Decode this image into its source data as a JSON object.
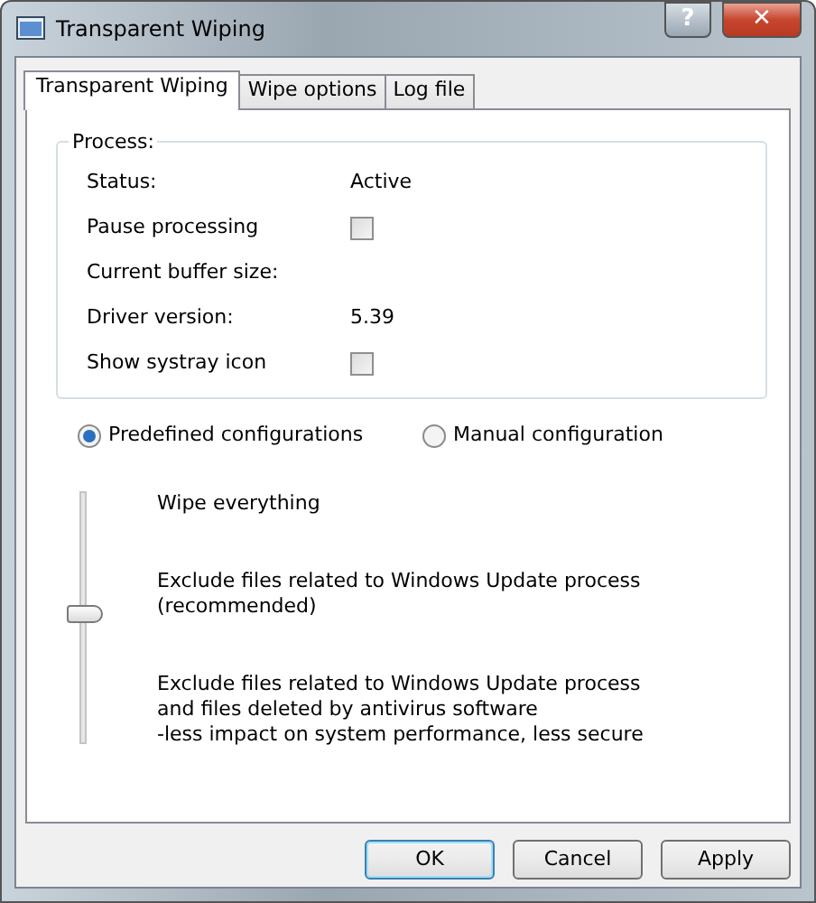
{
  "window": {
    "title": "Transparent Wiping",
    "help_button": "?",
    "close_button": "✕"
  },
  "tabs": [
    {
      "label": "Transparent Wiping",
      "selected": true
    },
    {
      "label": "Wipe options",
      "selected": false
    },
    {
      "label": "Log file",
      "selected": false
    }
  ],
  "process": {
    "title": "Process:",
    "rows": [
      {
        "kind": "value",
        "label": "Status:",
        "value": "Active"
      },
      {
        "kind": "checkbox",
        "label": "Pause processing",
        "checked": false
      },
      {
        "kind": "value",
        "label": "Current buffer size:"
      },
      {
        "kind": "value",
        "label": "Driver version:",
        "value": "5.39"
      },
      {
        "kind": "checkbox",
        "label": "Show systray icon",
        "checked": false
      }
    ]
  },
  "modes": [
    {
      "label": "Predefined configurations",
      "selected": true
    },
    {
      "label": "Manual configuration",
      "selected": false
    }
  ],
  "preset_slider": {
    "level": 0.5,
    "options": [
      [
        "Wipe everything"
      ],
      [
        "Exclude files related to Windows Update process",
        "(recommended)"
      ],
      [
        "Exclude files related to Windows Update process",
        "and files deleted by antivirus software",
        "-less impact on system performance, less secure"
      ]
    ]
  },
  "buttons": [
    {
      "label": "OK",
      "default": true
    },
    {
      "label": "Cancel",
      "default": false
    },
    {
      "label": "Apply",
      "default": false
    }
  ]
}
